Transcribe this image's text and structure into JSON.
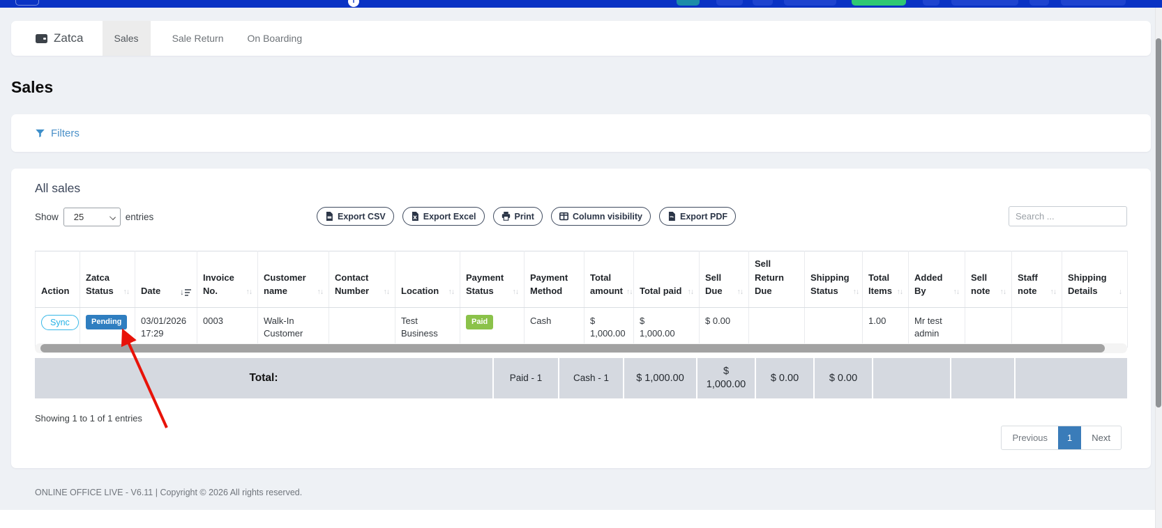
{
  "icons": {
    "info": "i",
    "sort": "↑↓",
    "sort_desc": "↓"
  },
  "tabs": {
    "brand": "Zatca",
    "items": [
      {
        "label": "Sales"
      },
      {
        "label": "Sale Return"
      },
      {
        "label": "On Boarding"
      }
    ],
    "active": "Sales"
  },
  "page": {
    "title": "Sales"
  },
  "filters": {
    "label": "Filters"
  },
  "main": {
    "title": "All sales"
  },
  "controls": {
    "show": "Show",
    "entries": "entries",
    "page_length": "25",
    "search_placeholder": "Search ...",
    "buttons": [
      "Export CSV",
      "Export Excel",
      "Print",
      "Column visibility",
      "Export PDF"
    ]
  },
  "table": {
    "columns": [
      {
        "label": "Action",
        "sort": "none"
      },
      {
        "label": "Zatca Status",
        "sort": "both"
      },
      {
        "label": "Date",
        "sort": "desc"
      },
      {
        "label": "Invoice No.",
        "sort": "both"
      },
      {
        "label": "Customer name",
        "sort": "both"
      },
      {
        "label": "Contact Number",
        "sort": "both"
      },
      {
        "label": "Location",
        "sort": "both"
      },
      {
        "label": "Payment Status",
        "sort": "both"
      },
      {
        "label": "Payment Method",
        "sort": "none"
      },
      {
        "label": "Total amount",
        "sort": "both"
      },
      {
        "label": "Total paid",
        "sort": "both"
      },
      {
        "label": "Sell Due",
        "sort": "both"
      },
      {
        "label": "Sell Return Due",
        "sort": "none"
      },
      {
        "label": "Shipping Status",
        "sort": "both"
      },
      {
        "label": "Total Items",
        "sort": "both"
      },
      {
        "label": "Added By",
        "sort": "both"
      },
      {
        "label": "Sell note",
        "sort": "both"
      },
      {
        "label": "Staff note",
        "sort": "both"
      },
      {
        "label": "Shipping Details",
        "sort": "down"
      }
    ],
    "row": {
      "action": "Sync",
      "zatca_status": "Pending",
      "date": "03/01/2026 17:29",
      "invoice_no": "0003",
      "customer_name": "Walk-In Customer",
      "contact_number": "",
      "location": "Test Business",
      "payment_status": "Paid",
      "payment_method": "Cash",
      "total_amount": "$ 1,000.00",
      "total_paid": "$ 1,000.00",
      "sell_due": "$ 0.00",
      "sell_return_due": "",
      "shipping_status": "",
      "total_items": "1.00",
      "added_by": "Mr test admin",
      "sell_note": "",
      "staff_note": "",
      "shipping_details": ""
    },
    "total": {
      "label": "Total:",
      "payment_status": "Paid - 1",
      "payment_method": "Cash - 1",
      "total_amount": "$ 1,000.00",
      "total_paid": "$ 1,000.00",
      "sell_due": "$ 0.00",
      "sell_return_due": "$ 0.00"
    }
  },
  "summary": "Showing 1 to 1 of 1 entries",
  "pagination": {
    "previous": "Previous",
    "page": "1",
    "next": "Next"
  },
  "footer": "ONLINE OFFICE LIVE - V6.11 | Copyright © 2026 All rights reserved."
}
